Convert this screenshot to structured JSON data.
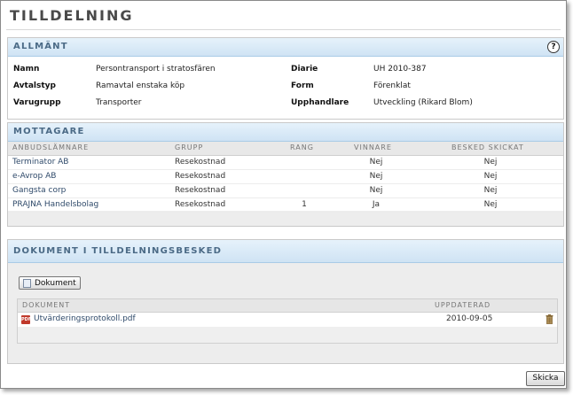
{
  "page": {
    "title": "TILLDELNING"
  },
  "general": {
    "header": "ALLMÄNT",
    "help_icon": "?",
    "fields": {
      "namn_label": "Namn",
      "namn_value": "Persontransport i stratosfären",
      "avtalstyp_label": "Avtalstyp",
      "avtalstyp_value": "Ramavtal enstaka köp",
      "varugrupp_label": "Varugrupp",
      "varugrupp_value": "Transporter",
      "diarie_label": "Diarie",
      "diarie_value": "UH 2010-387",
      "form_label": "Form",
      "form_value": "Förenklat",
      "upphandlare_label": "Upphandlare",
      "upphandlare_value": "Utveckling (Rikard Blom)"
    }
  },
  "recipients": {
    "header": "MOTTAGARE",
    "columns": {
      "company": "ANBUDSLÄMNARE",
      "group": "GRUPP",
      "rank": "RANG",
      "winner": "VINNARE",
      "notice": "BESKED SKICKAT"
    },
    "rows": [
      {
        "company": "Terminator AB",
        "group": "Resekostnad",
        "rank": "",
        "winner": "Nej",
        "notice": "Nej"
      },
      {
        "company": "e-Avrop AB",
        "group": "Resekostnad",
        "rank": "",
        "winner": "Nej",
        "notice": "Nej"
      },
      {
        "company": "Gangsta corp",
        "group": "Resekostnad",
        "rank": "",
        "winner": "Nej",
        "notice": "Nej"
      },
      {
        "company": "PRAJNA Handelsbolag",
        "group": "Resekostnad",
        "rank": "1",
        "winner": "Ja",
        "notice": "Nej"
      }
    ]
  },
  "documents": {
    "header": "DOKUMENT I TILLDELNINGSBESKED",
    "button_label": "Dokument",
    "columns": {
      "document": "DOKUMENT",
      "updated": "UPPDATERAD"
    },
    "rows": [
      {
        "icon": "pdf-icon",
        "name": "Utvärderingsprotokoll.pdf",
        "updated": "2010-09-05"
      }
    ]
  },
  "actions": {
    "send_label": "Skicka"
  }
}
